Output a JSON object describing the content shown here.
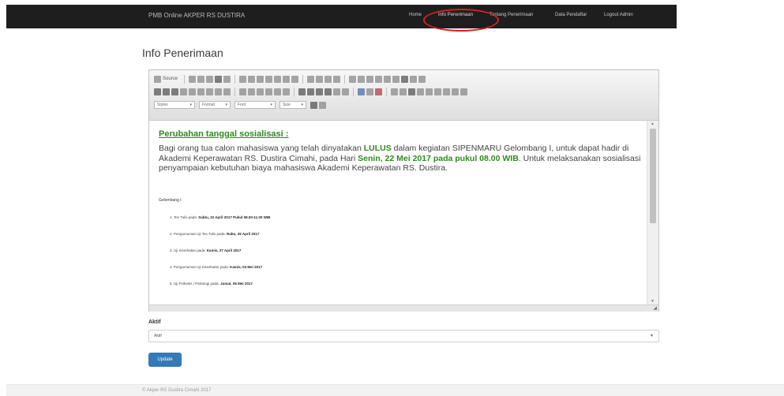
{
  "navbar": {
    "brand": "PMB Online AKPER RS DUSTIRA",
    "links": [
      "Home",
      "Info Penerimaan",
      "Tentang Penerimaan",
      "Data Pendaftar",
      "Logout Admin"
    ],
    "active": "Info Penerimaan",
    "highlight_color": "#d82020"
  },
  "page": {
    "title": "Info Penerimaan"
  },
  "editor": {
    "toolbar": {
      "source_label": "Source",
      "styles_label": "Styles",
      "format_label": "Format",
      "font_label": "Font",
      "size_label": "Size"
    },
    "heading": "Perubahan tanggal sosialisasi :",
    "paragraph": {
      "p1": "Bagi orang tua calon mahasiswa yang telah dinyatakan ",
      "b1": "LULUS",
      "p2": " dalam kegiatan SIPENMARU Gelombang I, untuk dapat hadir di Akademi Keperawatan RS. Dustira Cimahi, pada Hari ",
      "b2": "Senin, 22 Mei 2017 pada pukul 08.00 WIB",
      "p3": ". Untuk melaksanakan sosialisasi penyampaian kebutuhan biaya mahasiswa Akademi Keperawatan RS. Dustira."
    },
    "gelombang_label": "Gelombang I",
    "schedule": [
      {
        "num": "1.",
        "text": "Tes Tulis pada: ",
        "date": "Sabtu, 22 April 2017 Pukul 08.00-11.00 WIB"
      },
      {
        "num": "2.",
        "text": "Pengumuman Uji Tes Tulis pada: ",
        "date": "Rabu, 26 April 2017"
      },
      {
        "num": "3.",
        "text": "Uji Kesehatan pada: ",
        "date": "Kamis, 27 April 2017"
      },
      {
        "num": "4.",
        "text": "Pengumuman Uji Kesehatan pada: ",
        "date": "Kamis, 04 Mei 2017"
      },
      {
        "num": "5.",
        "text": "Uji Psikotes / Psikologi pada: ",
        "date": "Jumat, 05 Mei 2017"
      }
    ],
    "accent_color": "#2e8b1e"
  },
  "form": {
    "field_label": "Aktif",
    "select_value": "Aktif",
    "submit_label": "Update",
    "button_color": "#337ab7"
  },
  "footer": {
    "text": "© Akper RS Dustira Cimahi 2017"
  }
}
